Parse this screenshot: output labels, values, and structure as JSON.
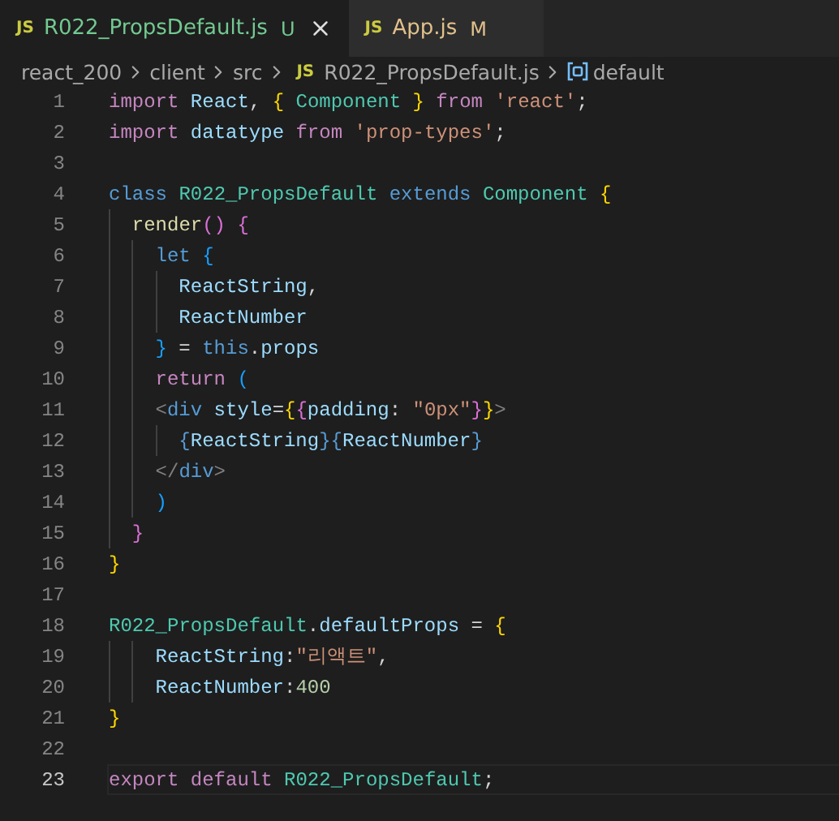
{
  "tabs": [
    {
      "icon_text": "JS",
      "label": "R022_PropsDefault.js",
      "badge": "U",
      "selected": true,
      "color": "#73c991"
    },
    {
      "icon_text": "JS",
      "label": "App.js",
      "badge": "M",
      "selected": false,
      "color": "#e2c08d"
    }
  ],
  "breadcrumbs": {
    "path": [
      "react_200",
      "client",
      "src"
    ],
    "file_icon_text": "JS",
    "file": "R022_PropsDefault.js",
    "symbol": "default"
  },
  "lines": [
    {
      "number": "1",
      "current": false,
      "tokens": [
        {
          "kind": "kw",
          "text": "import "
        },
        {
          "kind": "var",
          "text": "React"
        },
        {
          "kind": "plain",
          "text": ", "
        },
        {
          "kind": "b1",
          "text": "{ "
        },
        {
          "kind": "type",
          "text": "Component"
        },
        {
          "kind": "b1",
          "text": " }"
        },
        {
          "kind": "kw",
          "text": " from "
        },
        {
          "kind": "str",
          "text": "'react'"
        },
        {
          "kind": "plain",
          "text": ";"
        }
      ]
    },
    {
      "number": "2",
      "current": false,
      "tokens": [
        {
          "kind": "kw",
          "text": "import "
        },
        {
          "kind": "var",
          "text": "datatype"
        },
        {
          "kind": "kw",
          "text": " from "
        },
        {
          "kind": "str",
          "text": "'prop-types'"
        },
        {
          "kind": "plain",
          "text": ";"
        }
      ]
    },
    {
      "number": "3",
      "current": false
    },
    {
      "number": "4",
      "current": false,
      "tokens": [
        {
          "kind": "storage",
          "text": "class "
        },
        {
          "kind": "type",
          "text": "R022_PropsDefault"
        },
        {
          "kind": "storage",
          "text": " extends "
        },
        {
          "kind": "type",
          "text": "Component"
        },
        {
          "kind": "b1",
          "text": " {"
        }
      ]
    },
    {
      "number": "5",
      "kind": "one",
      "current": false,
      "tokens": [
        {
          "kind": "fn",
          "text": "render"
        },
        {
          "kind": "b2",
          "text": "() {"
        }
      ]
    },
    {
      "number": "6",
      "kind": "two",
      "current": false,
      "tokens": [
        {
          "kind": "storage",
          "text": "let "
        },
        {
          "kind": "b3",
          "text": "{"
        }
      ]
    },
    {
      "number": "7",
      "kind": "three",
      "current": false,
      "tokens": [
        {
          "kind": "var",
          "text": "ReactString"
        },
        {
          "kind": "plain",
          "text": ","
        }
      ]
    },
    {
      "number": "8",
      "kind": "three",
      "current": false,
      "tokens": [
        {
          "kind": "var",
          "text": "ReactNumber"
        }
      ]
    },
    {
      "number": "9",
      "kind": "two",
      "current": false,
      "tokens": [
        {
          "kind": "b3",
          "text": "}"
        },
        {
          "kind": "plain",
          "text": " = "
        },
        {
          "kind": "storage",
          "text": "this"
        },
        {
          "kind": "plain",
          "text": "."
        },
        {
          "kind": "var",
          "text": "props"
        }
      ]
    },
    {
      "number": "10",
      "kind": "two",
      "current": false,
      "tokens": [
        {
          "kind": "kw",
          "text": "return "
        },
        {
          "kind": "b3",
          "text": "("
        }
      ]
    },
    {
      "number": "11",
      "kind": "two",
      "current": false,
      "tokens": [
        {
          "kind": "tag",
          "text": "<"
        },
        {
          "kind": "storage",
          "text": "div "
        },
        {
          "kind": "var",
          "text": "style"
        },
        {
          "kind": "plain",
          "text": "="
        },
        {
          "kind": "b1",
          "text": "{"
        },
        {
          "kind": "b2",
          "text": "{"
        },
        {
          "kind": "var",
          "text": "padding"
        },
        {
          "kind": "plain",
          "text": ": "
        },
        {
          "kind": "str",
          "text": "\"0px\""
        },
        {
          "kind": "b2",
          "text": "}"
        },
        {
          "kind": "b1",
          "text": "}"
        },
        {
          "kind": "tag",
          "text": ">"
        }
      ]
    },
    {
      "number": "12",
      "kind": "three",
      "current": false,
      "tokens": [
        {
          "kind": "storage",
          "text": "{"
        },
        {
          "kind": "var",
          "text": "ReactString"
        },
        {
          "kind": "storage",
          "text": "}{"
        },
        {
          "kind": "var",
          "text": "ReactNumber"
        },
        {
          "kind": "storage",
          "text": "}"
        }
      ]
    },
    {
      "number": "13",
      "kind": "two",
      "current": false,
      "tokens": [
        {
          "kind": "tag",
          "text": "</"
        },
        {
          "kind": "storage",
          "text": "div"
        },
        {
          "kind": "tag",
          "text": ">"
        }
      ]
    },
    {
      "number": "14",
      "kind": "two",
      "current": false,
      "tokens": [
        {
          "kind": "b3",
          "text": ")"
        }
      ]
    },
    {
      "number": "15",
      "kind": "one",
      "current": false,
      "tokens": [
        {
          "kind": "b2",
          "text": "}"
        }
      ]
    },
    {
      "number": "16",
      "current": false,
      "tokens": [
        {
          "kind": "b1",
          "text": "}"
        }
      ]
    },
    {
      "number": "17",
      "current": false
    },
    {
      "number": "18",
      "current": false,
      "tokens": [
        {
          "kind": "type",
          "text": "R022_PropsDefault"
        },
        {
          "kind": "plain",
          "text": "."
        },
        {
          "kind": "var",
          "text": "defaultProps"
        },
        {
          "kind": "plain",
          "text": " = "
        },
        {
          "kind": "b1",
          "text": "{"
        }
      ]
    },
    {
      "number": "19",
      "kind": "two",
      "current": false,
      "tokens": [
        {
          "kind": "var",
          "text": "ReactString"
        },
        {
          "kind": "plain",
          "text": ":"
        },
        {
          "kind": "str",
          "text": "\"리액트\""
        },
        {
          "kind": "plain",
          "text": ","
        }
      ]
    },
    {
      "number": "20",
      "kind": "two",
      "current": false,
      "tokens": [
        {
          "kind": "var",
          "text": "ReactNumber"
        },
        {
          "kind": "plain",
          "text": ":"
        },
        {
          "kind": "num",
          "text": "400"
        }
      ]
    },
    {
      "number": "21",
      "current": false,
      "tokens": [
        {
          "kind": "b1",
          "text": "}"
        }
      ]
    },
    {
      "number": "22",
      "current": false
    },
    {
      "number": "23",
      "current": true,
      "tokens": [
        {
          "kind": "kw",
          "text": "export default "
        },
        {
          "kind": "type",
          "text": "R022_PropsDefault"
        },
        {
          "kind": "plain",
          "text": ";"
        }
      ]
    }
  ]
}
